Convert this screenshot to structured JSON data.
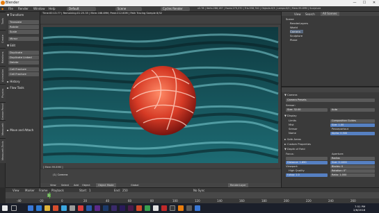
{
  "window": {
    "title": "Blender",
    "min": "—",
    "max": "☐",
    "close": "✕"
  },
  "menu": {
    "items": [
      "File",
      "Render",
      "Window",
      "Help"
    ],
    "layout": "Default",
    "scene": "Scene",
    "engine": "Cycles Render",
    "info": "v2.78 | Verts:286,187 | Faces:279,370 | Tris:558,740 | Objects:0/3 | Lamps:0/0 | Mem:99.89M | Sculpture"
  },
  "tabs": [
    "Tools",
    "Create",
    "Relations",
    "Animation",
    "Physics",
    "Grease Pencil",
    "MeasureIt",
    "MeasureIt-Tools"
  ],
  "tools": {
    "transform_header": "▼ Transform",
    "transform": [
      "Translate",
      "Rotate",
      "Scale"
    ],
    "mirror": "Mirror",
    "edit_header": "▼ Edit",
    "edit": [
      "Duplicate",
      "Duplicate Linked",
      "Delete"
    ],
    "join": [
      "Cell Fracture",
      "Cell Fracture"
    ],
    "history": "► History",
    "flowtools": "► Flow Tools",
    "move_attach": "► Move and Attach"
  },
  "viewport": {
    "header": "Time:00:13.77 | Remaining:01:25.35 | Mem:168.89M, Peak:212.60M | Path Tracing Sample 8/32",
    "object_label": "(1) Camera",
    "stats": "[ Mem:99.89M ]",
    "footer_items": [
      "View",
      "Select",
      "Add",
      "Object",
      "Object Mode",
      "Global",
      "RenderLayer"
    ]
  },
  "outliner": {
    "header_items": [
      "View",
      "Search",
      "All Scenes"
    ],
    "rows": [
      "Scene",
      "RenderLayers",
      "World",
      "Camera",
      "Sculpture",
      "Plane"
    ]
  },
  "properties": {
    "camera_header": "▼ Camera",
    "presets": "Camera Presets",
    "sensor_label": "Sensor:",
    "size_label": "Size:",
    "size_val": "32.00",
    "auto": "Auto",
    "display_header": "▼ Display",
    "limits": "Limits",
    "composition": "Composition Guides",
    "mist": "Mist",
    "sensor2": "Sensor",
    "name": "Name",
    "size2_label": "Size:",
    "size2_val": "1.00",
    "passepartout": "Passepartout",
    "alpha_label": "Alpha:",
    "alpha_val": "0.500",
    "safe_areas": "► Safe Areas",
    "custom_props": "► Custom Properties",
    "dof_header": "▼ Depth of Field",
    "focus": "Focus:",
    "aperture": "Aperture:",
    "radius": "Radius",
    "distance_label": "Distance:",
    "distance_val": "1.690",
    "size3_label": "Size:",
    "size3_val": "0.1000",
    "viewport_label": "Viewport:",
    "blades_label": "Blades:",
    "blades_val": "0",
    "high_quality": "High Quality",
    "rotation_label": "Rotation:",
    "rotation_val": "0°",
    "fstop_label": "f-stop:",
    "fstop_val": "1.0",
    "ratio_label": "Ratio:",
    "ratio_val": "1.000"
  },
  "timeline": {
    "head_items": [
      "View",
      "Marker",
      "Frame",
      "Playback",
      "Start:",
      "1",
      "End:",
      "250",
      "No Sync"
    ],
    "current": "1",
    "ticks": [
      "-40",
      "-20",
      "0",
      "20",
      "40",
      "60",
      "80",
      "100",
      "120",
      "140",
      "160",
      "180",
      "200",
      "220",
      "240",
      "260"
    ]
  },
  "taskbar": {
    "time": "7:51 PM",
    "date": "2/6/2018"
  }
}
